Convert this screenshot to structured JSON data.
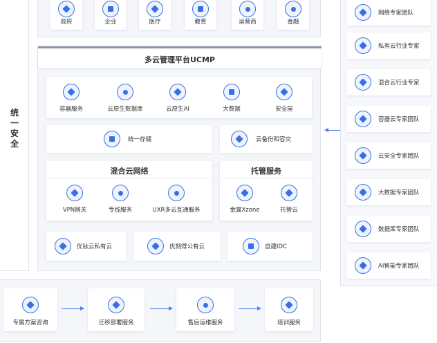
{
  "industries": [
    "政府",
    "企业",
    "医疗",
    "教育",
    "运营商",
    "金融"
  ],
  "security_label": [
    "统",
    "一",
    "安",
    "全"
  ],
  "ucmp": {
    "title": "多云管理平台UCMP"
  },
  "cloud_services": [
    "容器服务",
    "云原生数据库",
    "云原生AI",
    "大数据",
    "安全屋"
  ],
  "storage": {
    "unified": "统一存储",
    "backup": "云备份和容灾"
  },
  "hybrid": {
    "title": "混合云网络",
    "items": [
      "VPN网关",
      "专线服务",
      "UXR多云互通服务"
    ]
  },
  "hosting": {
    "title": "托管服务",
    "items": [
      "金翼Xzone",
      "托管云"
    ]
  },
  "clouds": [
    "优钛云私有云",
    "优刻得公有云",
    "自建IDC"
  ],
  "experts": [
    "网络专家团队",
    "私有云行业专家",
    "混合云行业专家",
    "容器云专家团队",
    "云安全专家团队",
    "大数据专家团队",
    "数据库专家团队",
    "AI智能专家团队"
  ],
  "process": [
    "专属方案咨询",
    "迁移部署服务",
    "售后运维服务",
    "培训服务"
  ],
  "colors": {
    "accent": "#3570e8",
    "panel": "#f4f6fa",
    "border": "#dfe4ec"
  }
}
